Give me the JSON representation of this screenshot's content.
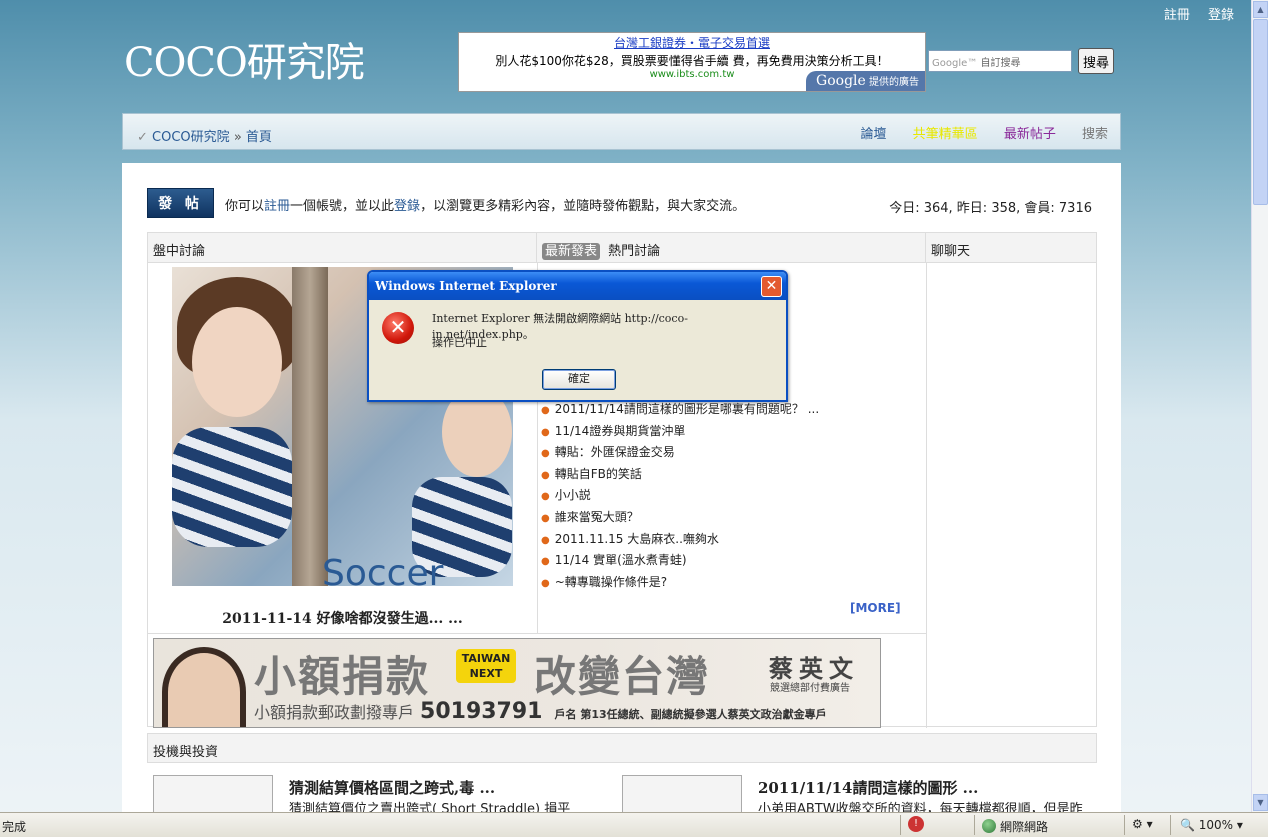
{
  "top_links": {
    "register": "註冊",
    "login": "登錄"
  },
  "logo": "COCO研究院",
  "ad": {
    "title": "台灣工銀證券・電子交易首選",
    "text": "別人花$100你花$28，買股票要懂得省手續 費，再免費用決策分析工具！",
    "url": "www.ibts.com.tw",
    "google": "Google",
    "google_suffix": "提供的廣告"
  },
  "search": {
    "placeholder": "自訂搜尋",
    "brand": "Google™",
    "button": "搜尋"
  },
  "nav": {
    "crumb_root": "COCO研究院",
    "crumb_sep": "»",
    "crumb_current": "首頁",
    "links": [
      "論壇",
      "共筆精華區",
      "最新帖子",
      "搜索"
    ],
    "link_colors": [
      "#2a5a94",
      "#e8e800",
      "#8a2a9a",
      "#777777"
    ]
  },
  "intro": {
    "post_button": "發 帖",
    "text_a": "你可以",
    "register_link": "註冊",
    "text_b": "一個帳號，並以此",
    "login_link": "登錄",
    "text_c": "，以瀏覽更多精彩內容，並隨時發佈觀點，與大家交流。",
    "stats": "今日: 364, 昨日: 358, 會員: 7316"
  },
  "columns": {
    "col1": "盤中討論",
    "col2_active": "最新發表",
    "col2": "熱門討論",
    "col3": "聊聊天"
  },
  "photo": {
    "label": "Soccer",
    "caption": "2011-11-14 好像啥都沒發生過... ..."
  },
  "topics": [
    "2011/11/14請問這樣的圖形是哪裏有問題呢？ ...",
    "11/14證券與期貨當沖單",
    "轉貼：外匯保證金交易",
    "轉貼自FB的笑話",
    "小小説",
    "誰來當冤大頭？",
    "2011.11.15 大島麻衣..嘸夠水",
    "11/14 實單(溫水煮青蛙)",
    "~轉專職操作條件是?"
  ],
  "more": "[MORE]",
  "banner": {
    "main": "小額捐款",
    "tag": "TAIWAN NEXT",
    "main2": "改變台灣",
    "name": "蔡英文",
    "sub": "競選總部付費廣告",
    "bottom": "小額捐款郵政劃撥專戶",
    "number": "50193791",
    "account": "戶名 第13任總統、副總統擬參選人蔡英文政治獻金專戶"
  },
  "section": "投機與投資",
  "articles": [
    {
      "title": "猜測結算價格區間之跨式,毒 ...",
      "summary": "猜測結算價位之賣出跨式( Short Straddle) 損平"
    },
    {
      "title": "2011/11/14請問這樣的圖形 ...",
      "summary": "小弟用ABTW收盤交所的資料，每天轉檔都很順，但是昨"
    }
  ],
  "dialog": {
    "title": "Windows Internet Explorer",
    "message": "Internet Explorer 無法開啟網際網站 http://coco-in.net/index.php。",
    "sub": "操作已中止",
    "ok": "確定"
  },
  "status": {
    "text": "完成",
    "zone": "網際網路",
    "zoom": "100%"
  }
}
